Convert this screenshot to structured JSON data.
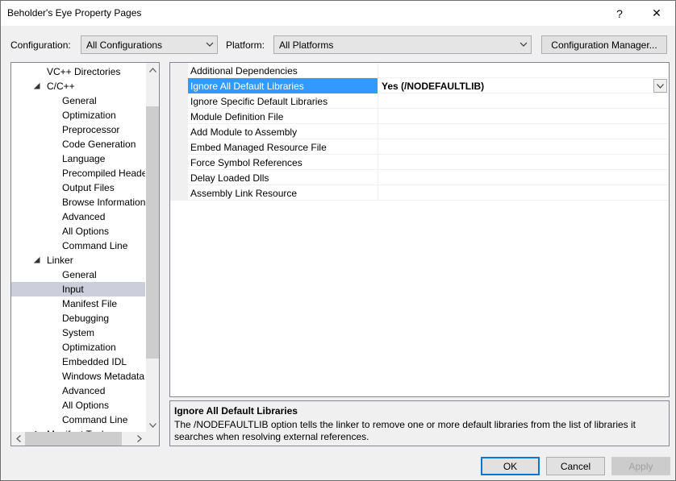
{
  "window": {
    "title": "Beholder's Eye Property Pages",
    "help_glyph": "?",
    "close_glyph": "✕"
  },
  "toolbar": {
    "configuration_label": "Configuration:",
    "configuration_value": "All Configurations",
    "platform_label": "Platform:",
    "platform_value": "All Platforms",
    "config_manager_label": "Configuration Manager..."
  },
  "tree": {
    "items": [
      {
        "label": "VC++ Directories"
      },
      {
        "label": "C/C++"
      },
      {
        "label": "General"
      },
      {
        "label": "Optimization"
      },
      {
        "label": "Preprocessor"
      },
      {
        "label": "Code Generation"
      },
      {
        "label": "Language"
      },
      {
        "label": "Precompiled Headers"
      },
      {
        "label": "Output Files"
      },
      {
        "label": "Browse Information"
      },
      {
        "label": "Advanced"
      },
      {
        "label": "All Options"
      },
      {
        "label": "Command Line"
      },
      {
        "label": "Linker"
      },
      {
        "label": "General"
      },
      {
        "label": "Input"
      },
      {
        "label": "Manifest File"
      },
      {
        "label": "Debugging"
      },
      {
        "label": "System"
      },
      {
        "label": "Optimization"
      },
      {
        "label": "Embedded IDL"
      },
      {
        "label": "Windows Metadata"
      },
      {
        "label": "Advanced"
      },
      {
        "label": "All Options"
      },
      {
        "label": "Command Line"
      },
      {
        "label": "Manifest Tool"
      }
    ],
    "selected": "Input"
  },
  "grid": {
    "rows": [
      {
        "name": "Additional Dependencies",
        "value": ""
      },
      {
        "name": "Ignore All Default Libraries",
        "value": "Yes (/NODEFAULTLIB)"
      },
      {
        "name": "Ignore Specific Default Libraries",
        "value": ""
      },
      {
        "name": "Module Definition File",
        "value": ""
      },
      {
        "name": "Add Module to Assembly",
        "value": ""
      },
      {
        "name": "Embed Managed Resource File",
        "value": ""
      },
      {
        "name": "Force Symbol References",
        "value": ""
      },
      {
        "name": "Delay Loaded Dlls",
        "value": ""
      },
      {
        "name": "Assembly Link Resource",
        "value": ""
      }
    ],
    "selected": "Ignore All Default Libraries"
  },
  "description": {
    "title": "Ignore All Default Libraries",
    "text": "The /NODEFAULTLIB option tells the linker to remove one or more default libraries from the list of libraries it searches when resolving external references."
  },
  "buttons": {
    "ok": "OK",
    "cancel": "Cancel",
    "apply": "Apply"
  }
}
